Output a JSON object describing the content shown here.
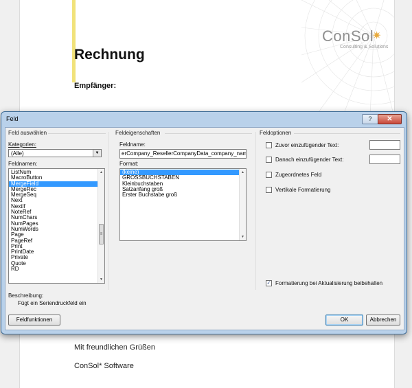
{
  "document": {
    "title": "Rechnung",
    "recipient_label": "Empfänger:",
    "greeting": "Mit freundlichen Grüßen",
    "signature": "ConSol* Software",
    "logo": {
      "name": "ConSol",
      "tagline": "Consulting & Solutions",
      "sun": "✷"
    },
    "accent_color": "#f1e27a"
  },
  "dialog": {
    "title": "Feld",
    "help_label": "?",
    "close_label": "✕",
    "left_group": {
      "title": "Feld auswählen",
      "category_label": "Kategorien:",
      "category_value": "(Alle)",
      "fieldnames_label": "Feldnamen:",
      "fieldnames": [
        "ListNum",
        "MacroButton",
        "MergeField",
        "MergeRec",
        "MergeSeq",
        "Next",
        "NextIf",
        "NoteRef",
        "NumChars",
        "NumPages",
        "NumWords",
        "Page",
        "PageRef",
        "Print",
        "PrintDate",
        "Private",
        "Quote",
        "RD"
      ],
      "selected_fieldname": "MergeField"
    },
    "middle_group": {
      "title": "Feldeigenschaften",
      "fieldname_label": "Feldname:",
      "fieldname_value": "erCompany_ResellerCompanyData_company_name",
      "format_label": "Format:",
      "formats": [
        "(keine)",
        "GROSSBUCHSTABEN",
        "Kleinbuchstaben",
        "Satzanfang groß",
        "Erster Buchstabe groß"
      ],
      "selected_format": "(keine)"
    },
    "right_group": {
      "title": "Feldoptionen",
      "before_text_label": "Zuvor einzufügender Text:",
      "after_text_label": "Danach einzufügender Text:",
      "mapped_field_label": "Zugeordnetes Feld",
      "vertical_format_label": "Vertikale Formatierung",
      "keep_format_label": "Formatierung bei Aktualisierung beibehalten",
      "keep_format_check": "✓"
    },
    "description_label": "Beschreibung:",
    "description_text": "Fügt ein Seriendruckfeld ein",
    "field_functions_label": "Feldfunktionen",
    "ok_label": "OK",
    "cancel_label": "Abbrechen"
  }
}
